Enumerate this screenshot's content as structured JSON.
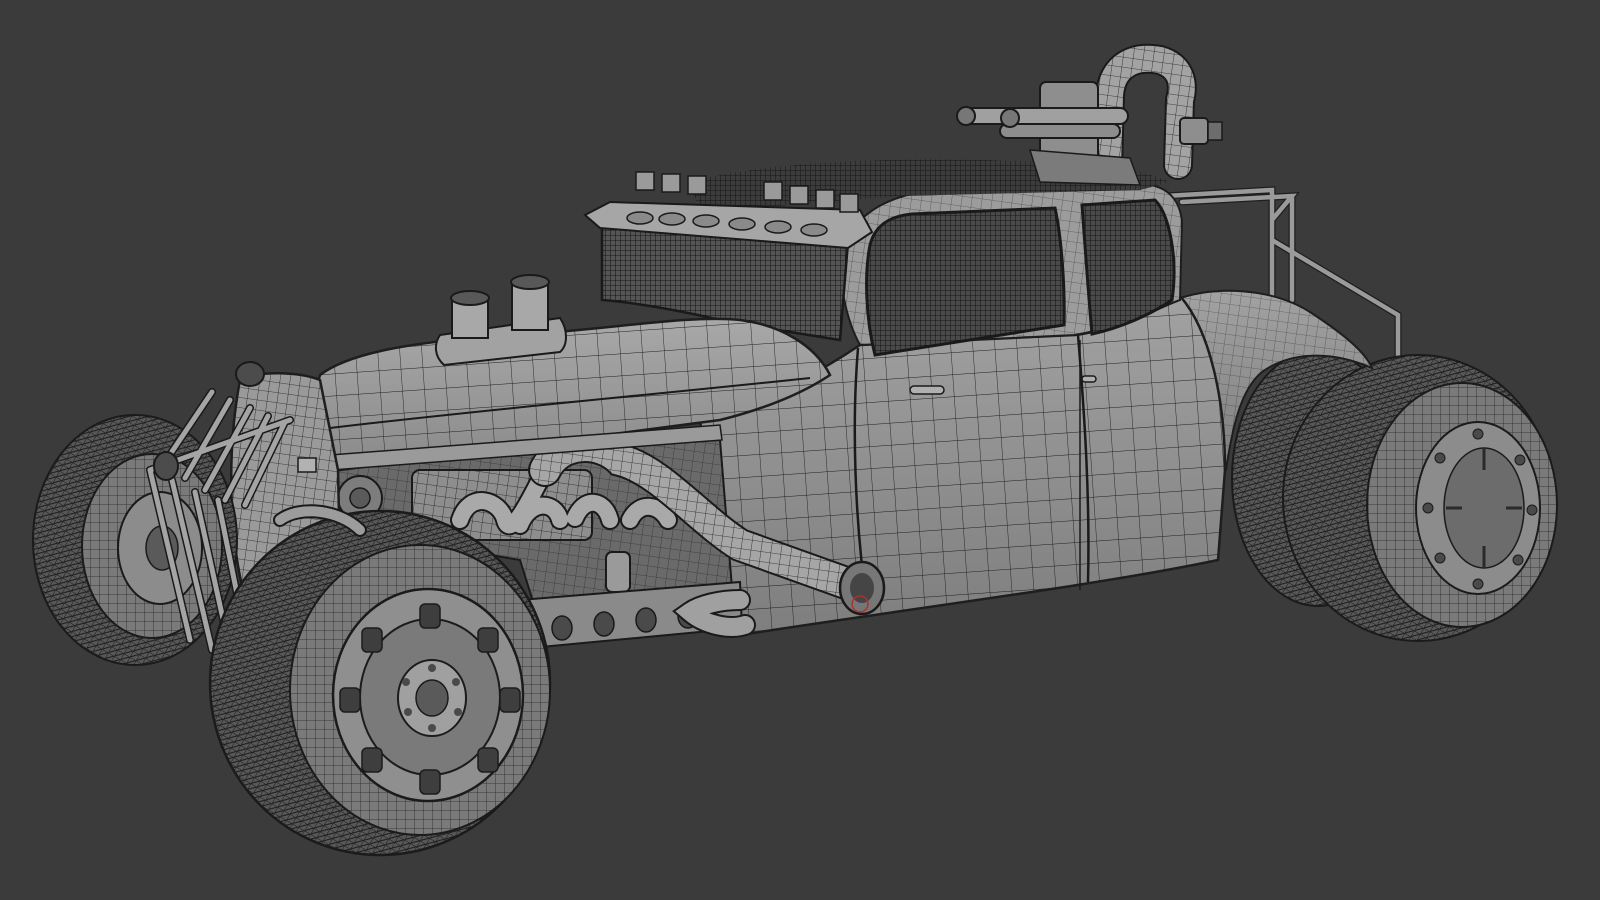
{
  "viewport": {
    "background": "#3b3b3b"
  },
  "model": {
    "subject": "hot-rod-coupe",
    "shading": "wireframe-on-shaded",
    "surface_color": "#8f8f8f",
    "surface_light_color": "#a4a4a4",
    "surface_dark_color": "#6e6e6e",
    "wire_color": "#1e1e1e",
    "tire_color": "#5d5d5d",
    "highlight_color": "#b03030"
  }
}
